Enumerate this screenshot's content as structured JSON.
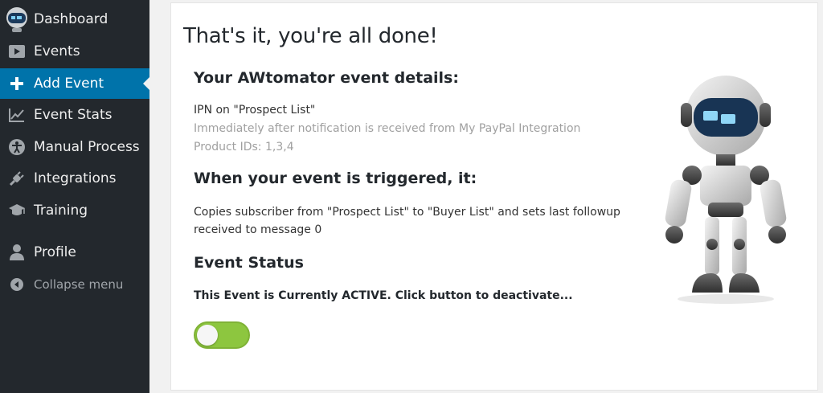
{
  "sidebar": {
    "items": [
      {
        "label": "Dashboard",
        "icon": "robot-avatar-icon"
      },
      {
        "label": "Events",
        "icon": "play-icon"
      },
      {
        "label": "Add Event",
        "icon": "plus-icon",
        "active": true
      },
      {
        "label": "Event Stats",
        "icon": "chart-line-icon"
      },
      {
        "label": "Manual Process",
        "icon": "accessibility-icon"
      },
      {
        "label": "Integrations",
        "icon": "plug-icon"
      },
      {
        "label": "Training",
        "icon": "graduation-cap-icon"
      },
      {
        "label": "Profile",
        "icon": "user-icon"
      },
      {
        "label": "Collapse menu",
        "icon": "collapse-arrow-icon"
      }
    ]
  },
  "main": {
    "title": "That's it, you're all done!",
    "details_heading": "Your AWtomator event details:",
    "details": {
      "event": "IPN on \"Prospect List\"",
      "timing": "Immediately after notification is received from My PayPal Integration",
      "products": "Product IDs: 1,3,4"
    },
    "trigger_heading": "When your event is triggered, it:",
    "trigger_line1": "Copies subscriber from \"Prospect List\" to \"Buyer List\" and sets last followup",
    "trigger_line2": "received to message 0",
    "status_heading": "Event Status",
    "status_text": "This Event is Currently ACTIVE. Click button to deactivate...",
    "toggle_on": true
  },
  "colors": {
    "sidebar_bg": "#23282d",
    "active_bg": "#0073aa",
    "toggle_on": "#8dc63f"
  }
}
